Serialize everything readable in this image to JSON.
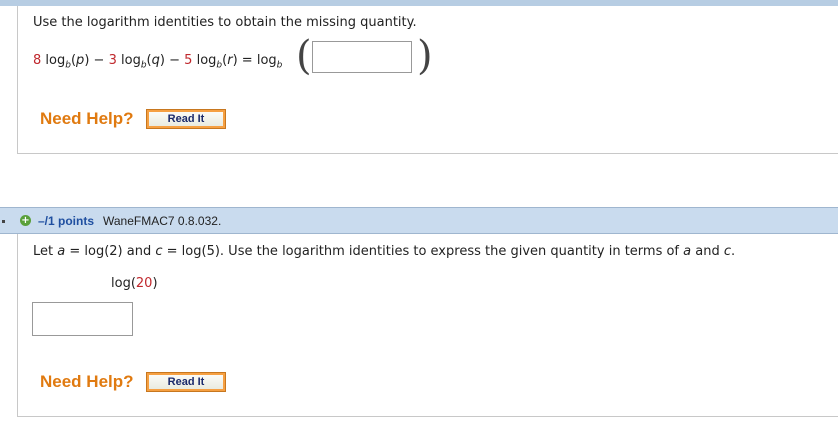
{
  "question1": {
    "prompt": "Use the logarithm identities to obtain the missing quantity.",
    "equation": {
      "coef1": "8",
      "log": "log",
      "base": "b",
      "var1": "p",
      "minus": "−",
      "coef2": "3",
      "var2": "q",
      "coef3": "5",
      "var3": "r",
      "equals": "="
    },
    "answer_value": "",
    "need_help_label": "Need Help?",
    "read_it_label": "Read It"
  },
  "question2": {
    "points_label": "–/1 points",
    "question_id": "WaneFMAC7 0.8.032.",
    "prompt_parts": {
      "let": "Let",
      "a": "a",
      "eq_a": "= log(2) and",
      "c": "c",
      "eq_c": "= log(5). Use the logarithm identities to express the given quantity in terms of",
      "and": "and",
      "end": "."
    },
    "expression_func": "log(",
    "expression_arg": "20",
    "expression_close": ")",
    "answer_value": "",
    "need_help_label": "Need Help?",
    "read_it_label": "Read It"
  },
  "colors": {
    "accent_orange": "#e07a10",
    "red_number": "#c0282d",
    "header_blue": "#c9dbee",
    "points_blue": "#1f4fa0"
  },
  "icons": {
    "expand": "plus-circle-icon"
  }
}
